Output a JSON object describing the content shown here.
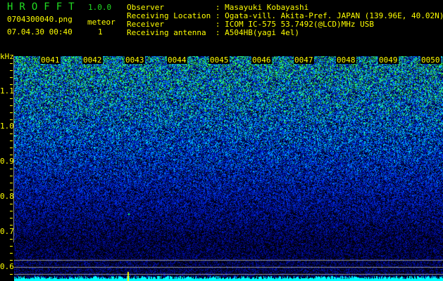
{
  "header": {
    "app_title": "HROFFT",
    "version": "1.0.0",
    "filename": "0704300040.png",
    "datetime": "07.04.30 00:40",
    "meteor_label": "meteor",
    "meteor_count": "1"
  },
  "info": [
    {
      "label": "Observer          ",
      "value": "Masayuki Kobayashi"
    },
    {
      "label": "Receiving Location",
      "value": "Ogata-vill. Akita-Pref. JAPAN (139.96E, 40.02N)"
    },
    {
      "label": "Receiver          ",
      "value": "ICOM IC-575 53.7492(@LCD)MHz USB"
    },
    {
      "label": "Receiving antenna ",
      "value": "A504HB(yagi 4el)"
    }
  ],
  "chart_data": {
    "type": "heatmap",
    "ylabel": "kHz",
    "ylim": [
      0.56,
      1.2
    ],
    "y_ticks": [
      "1.1",
      "1.0",
      "0.9",
      "0.8",
      "0.7",
      "0.6"
    ],
    "x_ticks": [
      "0041",
      "0042",
      "0043",
      "0044",
      "0045",
      "0046",
      "0047",
      "0048",
      "0049",
      "0050"
    ],
    "colors": {
      "low": "#000010",
      "mid": "#1030ff",
      "high": "#00ffff",
      "peak": "#20ff20",
      "level_bar": "#00ffff",
      "marker": "#ffff00",
      "text": "#ffff00",
      "title": "#22dd22"
    },
    "reference_lines_khz": [
      0.62,
      0.6,
      0.58
    ]
  }
}
